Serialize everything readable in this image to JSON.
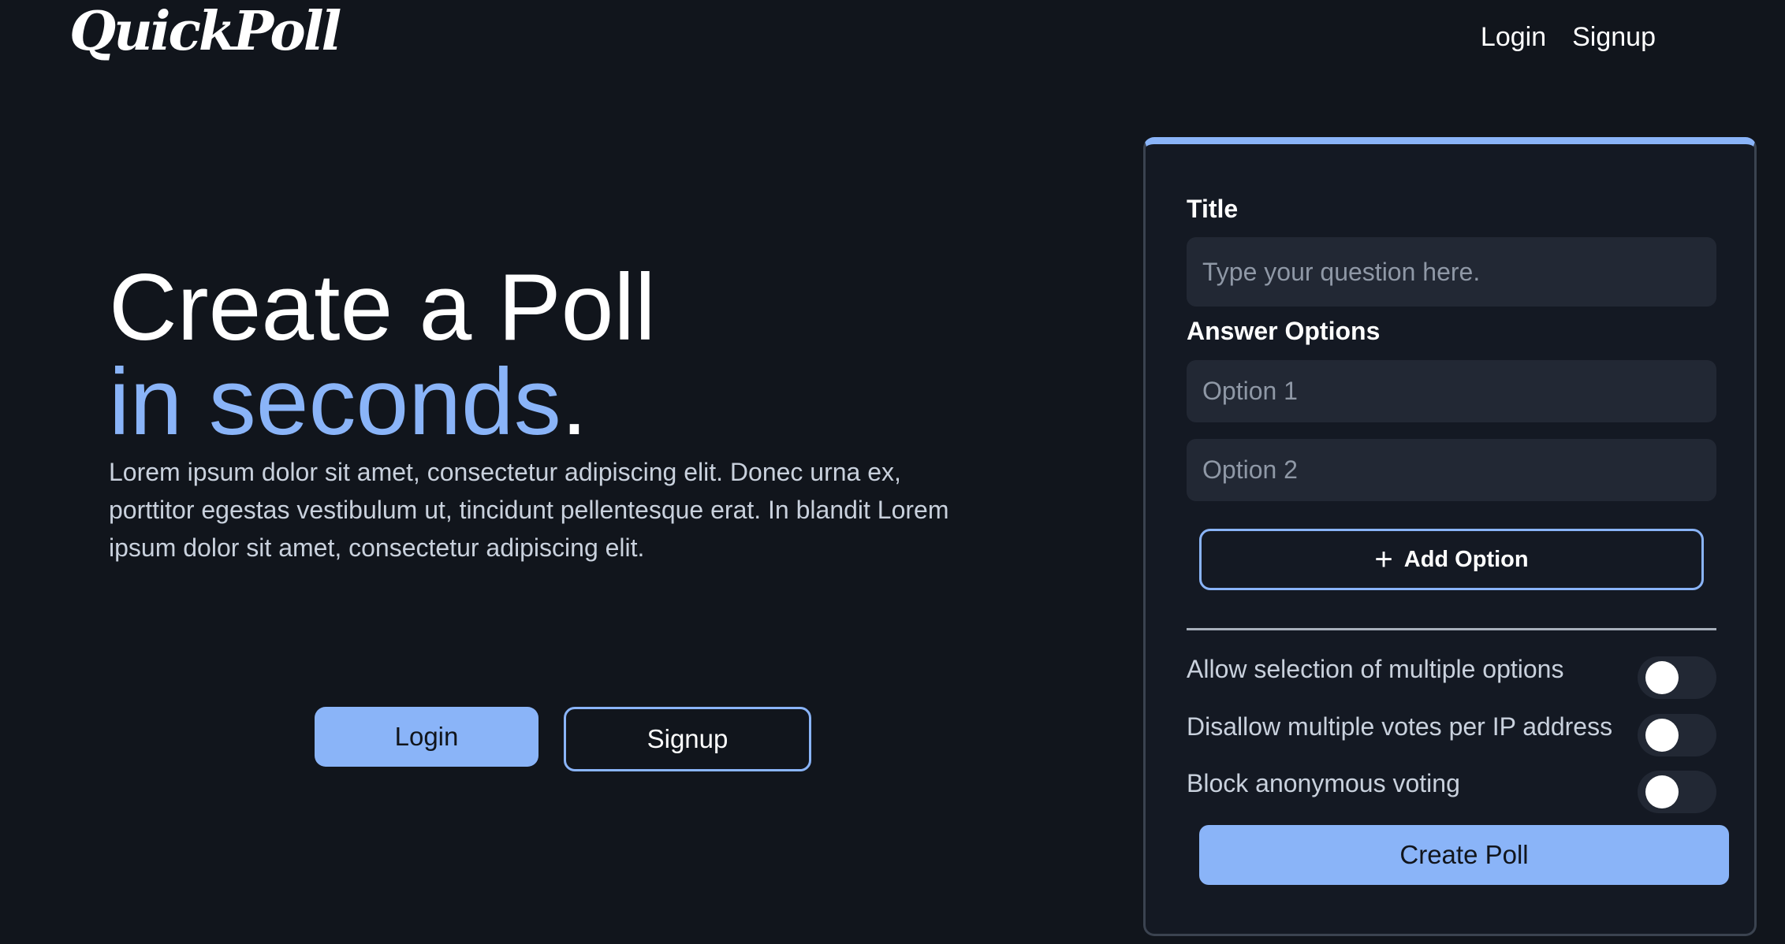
{
  "brand": {
    "logo": "QuickPoll"
  },
  "nav": {
    "login": "Login",
    "signup": "Signup"
  },
  "hero": {
    "title_line1": "Create a Poll",
    "title_line2_accent": "in seconds",
    "title_line2_end": ".",
    "body": "Lorem ipsum dolor sit amet, consectetur adipiscing elit. Donec urna ex, porttitor egestas vestibulum ut, tincidunt pellentesque erat. In blandit Lorem ipsum dolor sit amet, consectetur adipiscing elit.",
    "login_button": "Login",
    "signup_button": "Signup"
  },
  "form": {
    "title_label": "Title",
    "title_placeholder": "Type your question here.",
    "title_value": "",
    "answer_options_label": "Answer Options",
    "options": [
      {
        "placeholder": "Option 1",
        "value": ""
      },
      {
        "placeholder": "Option 2",
        "value": ""
      }
    ],
    "add_option_icon": "plus-icon",
    "add_option_label": "Add Option",
    "settings": [
      {
        "label": "Allow selection of multiple options",
        "enabled": false
      },
      {
        "label": "Disallow multiple votes per IP address",
        "enabled": false
      },
      {
        "label": "Block anonymous voting",
        "enabled": false
      }
    ],
    "create_button": "Create Poll"
  },
  "colors": {
    "background": "#11151c",
    "accent": "#8ab4f8",
    "card": "#141923",
    "input": "#222834",
    "muted_text": "#c9d1dd"
  }
}
